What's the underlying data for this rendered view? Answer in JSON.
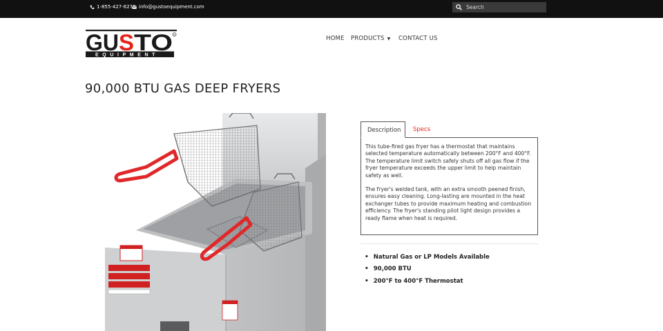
{
  "topbar": {
    "phone": "1-855-427-6273",
    "email": "info@gustoequipment.com",
    "search_placeholder": "Search"
  },
  "logo": {
    "brand": "GUSTO",
    "tagline": "EQUIPMENT"
  },
  "nav": {
    "items": [
      {
        "label": "HOME"
      },
      {
        "label": "PRODUCTS"
      },
      {
        "label": "CONTACT US"
      }
    ]
  },
  "page": {
    "title": "90,000 BTU GAS DEEP FRYERS"
  },
  "tabs": [
    {
      "label": "Description",
      "active": true
    },
    {
      "label": "Specs",
      "active": false
    }
  ],
  "description": {
    "paragraphs": [
      "This tube-fired gas fryer has a thermostat that maintains selected temperature automatically between 200°F and 400°F. The temperature limit switch safely shuts off all gas flow if the fryer temperature exceeds the upper limit to help maintain safety as well.",
      "The fryer's welded tank, with an extra smooth peened finish, ensures easy cleaning. Long-lasting are mounted in the heat exchanger tubes to provide maximum heating and combustion efficiency. The fryer's standing pilot light design provides a ready flame when heat is required."
    ]
  },
  "features": [
    "Natural Gas or LP Models Available",
    "90,000 BTU",
    "200°F to 400°F Thermostat"
  ],
  "colors": {
    "topbar": "#111111",
    "accent_red": "#e2231a",
    "handle_red": "#e0282a",
    "steel": "#c8c9cb"
  }
}
